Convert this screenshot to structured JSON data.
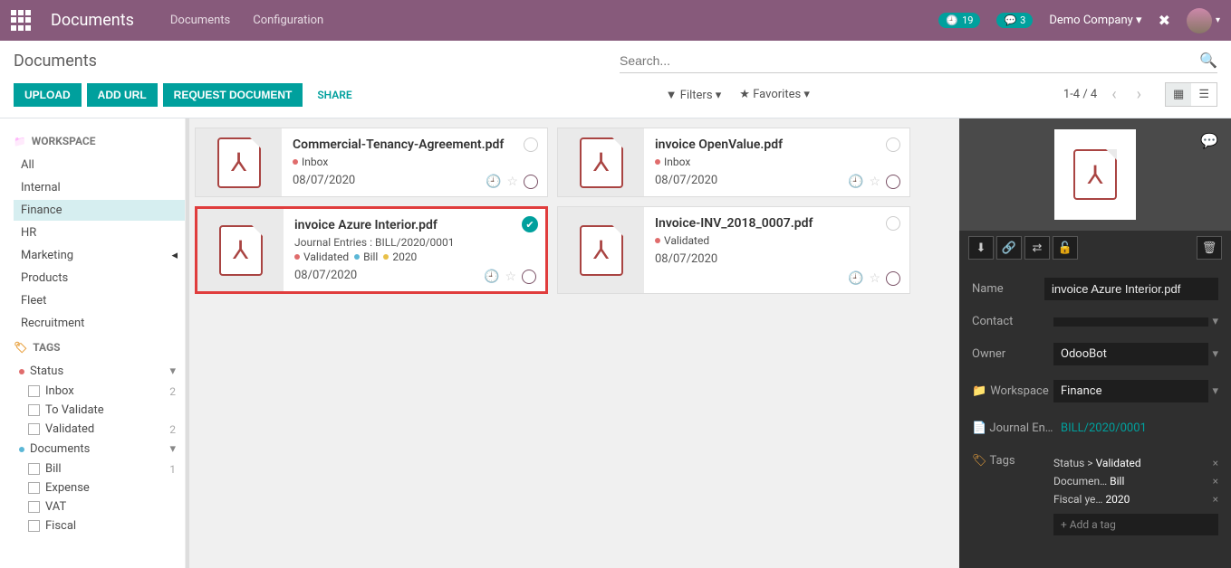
{
  "header": {
    "app_title": "Documents",
    "nav": [
      "Documents",
      "Configuration"
    ],
    "clock_badge": "19",
    "msg_badge": "3",
    "company": "Demo Company"
  },
  "toolbar": {
    "title": "Documents",
    "search_placeholder": "Search...",
    "buttons": {
      "upload": "UPLOAD",
      "add_url": "ADD URL",
      "request": "REQUEST DOCUMENT"
    },
    "share": "SHARE",
    "filters": "Filters",
    "favorites": "Favorites",
    "pager": "1-4 / 4"
  },
  "sidebar": {
    "workspace_header": "WORKSPACE",
    "workspaces": [
      "All",
      "Internal",
      "Finance",
      "HR",
      "Marketing",
      "Products",
      "Fleet",
      "Recruitment"
    ],
    "tags_header": "TAGS",
    "groups": [
      {
        "name": "Status",
        "items": [
          {
            "label": "Inbox",
            "count": "2"
          },
          {
            "label": "To Validate",
            "count": ""
          },
          {
            "label": "Validated",
            "count": "2"
          }
        ]
      },
      {
        "name": "Documents",
        "items": [
          {
            "label": "Bill",
            "count": "1"
          },
          {
            "label": "Expense",
            "count": ""
          },
          {
            "label": "VAT",
            "count": ""
          },
          {
            "label": "Fiscal",
            "count": ""
          }
        ]
      }
    ]
  },
  "cards": [
    {
      "title": "Commercial-Tenancy-Agreement.pdf",
      "sub": "",
      "tags": [
        {
          "color": "red",
          "label": "Inbox"
        }
      ],
      "date": "08/07/2020",
      "selected": false
    },
    {
      "title": "invoice OpenValue.pdf",
      "sub": "",
      "tags": [
        {
          "color": "red",
          "label": "Inbox"
        }
      ],
      "date": "08/07/2020",
      "selected": false
    },
    {
      "title": "invoice Azure Interior.pdf",
      "sub": "Journal Entries : BILL/2020/0001",
      "tags": [
        {
          "color": "red",
          "label": "Validated"
        },
        {
          "color": "blue",
          "label": "Bill"
        },
        {
          "color": "yellow",
          "label": "2020"
        }
      ],
      "date": "08/07/2020",
      "selected": true
    },
    {
      "title": "Invoice-INV_2018_0007.pdf",
      "sub": "",
      "tags": [
        {
          "color": "red",
          "label": "Validated"
        }
      ],
      "date": "08/07/2020",
      "selected": false
    }
  ],
  "details": {
    "name_label": "Name",
    "name": "invoice Azure Interior.pdf",
    "contact_label": "Contact",
    "contact": "",
    "owner_label": "Owner",
    "owner": "OdooBot",
    "workspace_label": "Workspace",
    "workspace": "Finance",
    "journal_label": "Journal En…",
    "journal": "BILL/2020/0001",
    "tags_label": "Tags",
    "tags": [
      {
        "group": "Status",
        "sep": ">",
        "val": "Validated"
      },
      {
        "group": "Documen…",
        "sep": "",
        "val": "Bill"
      },
      {
        "group": "Fiscal ye…",
        "sep": "",
        "val": "2020"
      }
    ],
    "add_tag": "+ Add a tag"
  }
}
